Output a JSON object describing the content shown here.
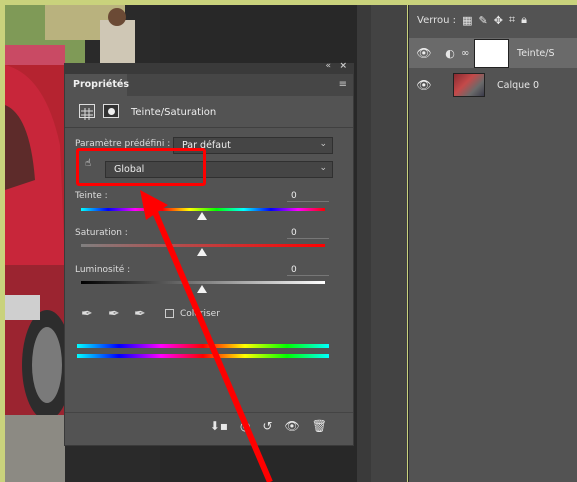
{
  "lock_bar": {
    "label": "Verrou :"
  },
  "layers": [
    {
      "name": "Teinte/S",
      "selected": true
    },
    {
      "name": "Calque 0",
      "selected": false
    }
  ],
  "properties": {
    "tab_label": "Propriétés",
    "adjustment_title": "Teinte/Saturation",
    "preset_label": "Paramètre prédéfini :",
    "preset_value": "Par défaut",
    "channel_value": "Global",
    "hue_label": "Teinte :",
    "hue_value": "0",
    "saturation_label": "Saturation :",
    "saturation_value": "0",
    "lightness_label": "Luminosité :",
    "lightness_value": "0",
    "colorize_label": "Coloriser",
    "colorize_checked": false
  },
  "colors": {
    "annotation": "#ff0000",
    "panel": "#535353"
  },
  "icons": [
    "close-icon",
    "collapse-icon",
    "panel-menu-icon",
    "hue-sat-icon",
    "mask-icon",
    "eyedropper-icon",
    "eyedropper-plus-icon",
    "eyedropper-minus-icon",
    "clip-icon",
    "view-previous-icon",
    "reset-icon",
    "visibility-icon",
    "trash-icon",
    "lock-transparent-icon",
    "lock-brush-icon",
    "lock-move-icon",
    "lock-artboard-icon",
    "lock-all-icon"
  ]
}
